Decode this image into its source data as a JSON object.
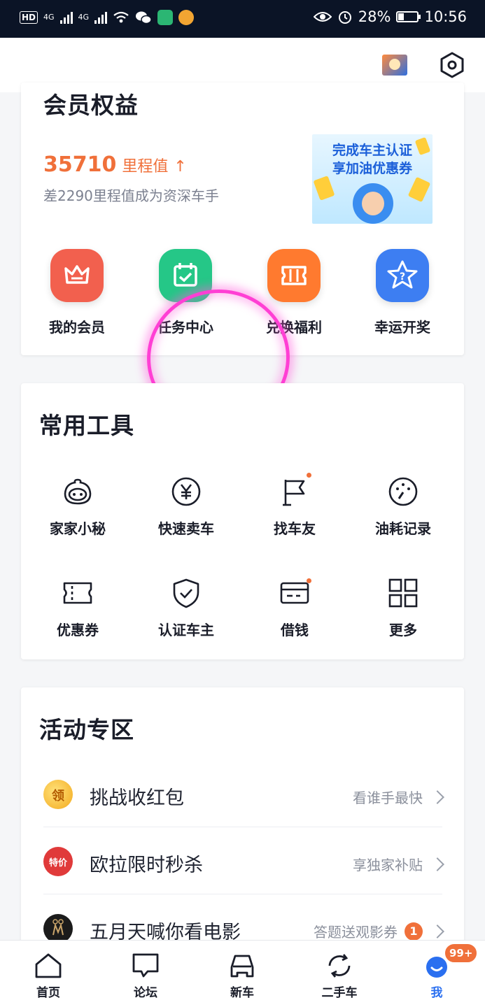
{
  "status_bar": {
    "hd": "HD",
    "net1": "4G",
    "net2": "4G",
    "battery": "28%",
    "time": "10:56"
  },
  "member": {
    "title": "会员权益",
    "mileage_value": "35710",
    "mileage_label": "里程值",
    "mileage_arrow": "↑",
    "mileage_sub": "差2290里程值成为资深车手",
    "banner_line1": "完成车主认证",
    "banner_line2": "享加油优惠券",
    "perks": [
      {
        "label": "我的会员",
        "color": "#f2604e"
      },
      {
        "label": "任务中心",
        "color": "#25c787"
      },
      {
        "label": "兑换福利",
        "color": "#ff7a2f"
      },
      {
        "label": "幸运开奖",
        "color": "#3d7ef2"
      }
    ]
  },
  "tools": {
    "title": "常用工具",
    "items": [
      {
        "label": "家家小秘",
        "icon": "assistant-face-icon"
      },
      {
        "label": "快速卖车",
        "icon": "yuan-icon"
      },
      {
        "label": "找车友",
        "icon": "flag-icon"
      },
      {
        "label": "油耗记录",
        "icon": "fuel-gauge-icon"
      },
      {
        "label": "优惠券",
        "icon": "coupon-icon"
      },
      {
        "label": "认证车主",
        "icon": "shield-check-icon"
      },
      {
        "label": "借钱",
        "icon": "card-icon"
      },
      {
        "label": "更多",
        "icon": "grid-icon"
      }
    ]
  },
  "activity": {
    "title": "活动专区",
    "rows": [
      {
        "name": "挑战收红包",
        "desc": "看谁手最快",
        "badge": ""
      },
      {
        "name": "欧拉限时秒杀",
        "desc": "享独家补贴",
        "badge": ""
      },
      {
        "name": "五月天喊你看电影",
        "desc": "答题送观影券",
        "badge": "1"
      }
    ],
    "icon_texts": [
      "领",
      "特价"
    ]
  },
  "nav": {
    "items": [
      {
        "label": "首页"
      },
      {
        "label": "论坛"
      },
      {
        "label": "新车"
      },
      {
        "label": "二手车"
      },
      {
        "label": "我"
      }
    ],
    "badge": "99+"
  }
}
